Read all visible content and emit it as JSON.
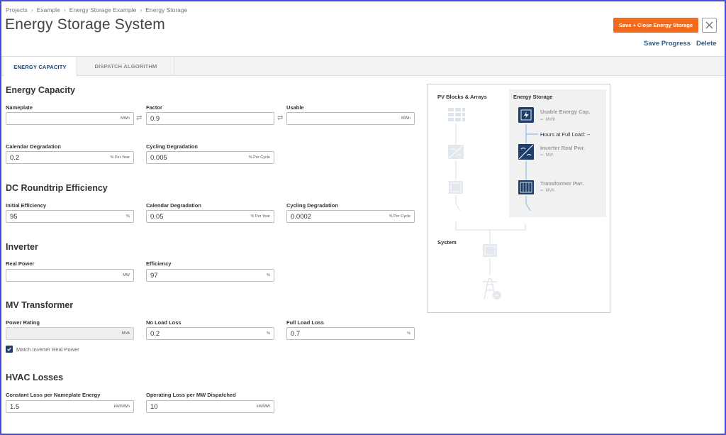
{
  "breadcrumb": [
    "Projects",
    "Example",
    "Energy Storage Example",
    "Energy Storage"
  ],
  "page_title": "Energy Storage System",
  "header": {
    "save_close_label": "Save + Close Energy Storage",
    "save_progress_label": "Save Progress",
    "delete_label": "Delete"
  },
  "tabs": [
    {
      "label": "ENERGY CAPACITY",
      "active": true
    },
    {
      "label": "DISPATCH ALGORITHM",
      "active": false
    }
  ],
  "sections": {
    "energy_capacity": {
      "title": "Energy Capacity",
      "nameplate": {
        "label": "Nameplate",
        "value": "",
        "unit": "MWh"
      },
      "factor": {
        "label": "Factor",
        "value": "0.9",
        "unit": ""
      },
      "usable": {
        "label": "Usable",
        "value": "",
        "unit": "MWh"
      },
      "calendar_degradation": {
        "label": "Calendar Degradation",
        "value": "0.2",
        "unit": "% Per Year"
      },
      "cycling_degradation": {
        "label": "Cycling Degradation",
        "value": "0.005",
        "unit": "% Per Cycle"
      }
    },
    "dc_roundtrip": {
      "title": "DC Roundtrip Efficiency",
      "initial_efficiency": {
        "label": "Initial Efficiency",
        "value": "95",
        "unit": "%"
      },
      "calendar_degradation": {
        "label": "Calendar Degradation",
        "value": "0.05",
        "unit": "% Per Year"
      },
      "cycling_degradation": {
        "label": "Cycling Degradation",
        "value": "0.0002",
        "unit": "% Per Cycle"
      }
    },
    "inverter": {
      "title": "Inverter",
      "real_power": {
        "label": "Real Power",
        "value": "",
        "unit": "MW"
      },
      "efficiency": {
        "label": "Efficiency",
        "value": "97",
        "unit": "%"
      }
    },
    "mv_transformer": {
      "title": "MV Transformer",
      "power_rating": {
        "label": "Power Rating",
        "value": "",
        "unit": "MVA"
      },
      "no_load_loss": {
        "label": "No Load Loss",
        "value": "0.2",
        "unit": "%"
      },
      "full_load_loss": {
        "label": "Full Load Loss",
        "value": "0.7",
        "unit": "%"
      },
      "match_label": "Match Inverter Real Power",
      "match_checked": true
    },
    "hvac": {
      "title": "HVAC Losses",
      "constant_loss": {
        "label": "Constant Loss per Nameplate Energy",
        "value": "1.5",
        "unit": "kW/MWh"
      },
      "operating_loss": {
        "label": "Operating Loss per MW Dispatched",
        "value": "10",
        "unit": "kW/MW"
      }
    }
  },
  "diagram": {
    "pv_title": "PV Blocks & Arrays",
    "es_title": "Energy Storage",
    "system_title": "System",
    "usable_cap_label": "Usable Energy Cap.",
    "usable_cap_value": "--",
    "usable_cap_unit": "MWh",
    "hours_label": "Hours at Full Load: --",
    "inverter_label": "Inverter Real Pwr.",
    "inverter_value": "--",
    "inverter_unit": "MW",
    "transformer_label": "Transformer Pwr.",
    "transformer_value": "--",
    "transformer_unit": "MVA",
    "accent_color": "#1f3f6a",
    "line_color": "#8fbfe8"
  },
  "colors": {
    "primary_button": "#f26b1d",
    "link": "#2a5a8c",
    "active_tab": "#1f3f6a"
  }
}
